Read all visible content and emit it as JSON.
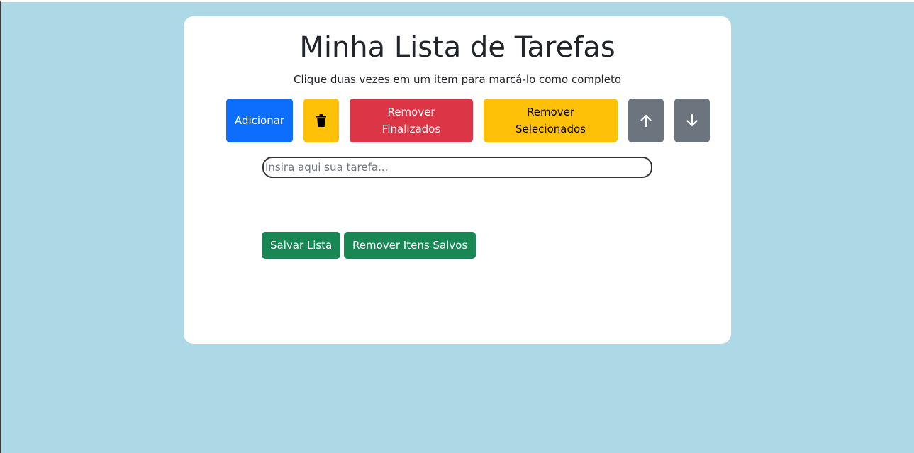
{
  "header": {
    "title": "Minha Lista de Tarefas",
    "subtitle": "Clique duas vezes em um item para marcá-lo como completo"
  },
  "toolbar": {
    "add_label": "Adicionar",
    "delete_icon": "trash-icon",
    "remove_finished_label": "Remover\nFinalizados",
    "remove_selected_label": "Remover\nSelecionados",
    "move_up_icon": "arrow-up-icon",
    "move_down_icon": "arrow-down-icon"
  },
  "task_input": {
    "value": "",
    "placeholder": "Insira aqui sua tarefa..."
  },
  "footer": {
    "save_label": "Salvar Lista",
    "remove_saved_label": "Remover Itens Salvos"
  },
  "colors": {
    "background": "#add8e6",
    "primary": "#0d6efd",
    "warning": "#ffc107",
    "danger": "#dc3545",
    "secondary": "#6c757d",
    "success": "#198754"
  }
}
